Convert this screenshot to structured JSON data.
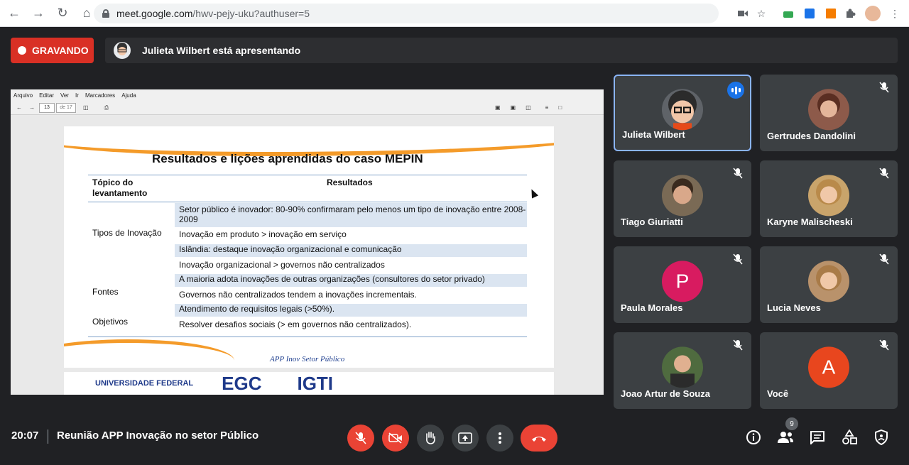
{
  "browser": {
    "url_host": "meet.google.com",
    "url_path": "/hwv-pejy-uku?authuser=5"
  },
  "banner": {
    "recording_label": "GRAVANDO",
    "presenting_text": "Julieta Wilbert está apresentando"
  },
  "pdf_viewer": {
    "menu": [
      "Arquivo",
      "Editar",
      "Ver",
      "Ir",
      "Marcadores",
      "Ajuda"
    ],
    "page_current": "13",
    "page_total": "de 17"
  },
  "slide": {
    "title": "Resultados e lições aprendidas do caso MEPIN",
    "col_topic": "Tópico do levantamento",
    "col_results": "Resultados",
    "row_labels": [
      "Tipos de Inovação",
      "Fontes",
      "Objetivos"
    ],
    "rows": [
      "Setor público é inovador: 80-90% confirmaram pelo menos um tipo de inovação entre 2008-2009",
      "Inovação em produto > inovação em serviço",
      "Islândia: destaque inovação organizacional e comunicação",
      "Inovação organizacional > governos não centralizados",
      "A maioria adota inovações de outras organizações (consultores do setor privado)",
      "Governos não centralizados tendem a inovações incrementais.",
      "Atendimento de requisitos legais (>50%).",
      "Resolver desafios sociais (> em governos não centralizados)."
    ],
    "footer": "APP Inov Setor Público",
    "logos": [
      "UNIVERSIDADE FEDERAL",
      "EGC",
      "IGTI"
    ]
  },
  "participants": [
    {
      "name": "Julieta Wilbert",
      "speaking": true,
      "avatar_color": "#5f6368"
    },
    {
      "name": "Gertrudes Dandolini",
      "muted": true,
      "avatar_color": "#8d5a4a"
    },
    {
      "name": "Tiago Giuriatti",
      "muted": true,
      "avatar_color": "#7a6a55"
    },
    {
      "name": "Karyne Malischeski",
      "muted": true,
      "avatar_color": "#c9a46b"
    },
    {
      "name": "Paula Morales",
      "muted": true,
      "initial": "P",
      "avatar_color": "#d81b60"
    },
    {
      "name": "Lucia Neves",
      "muted": true,
      "avatar_color": "#b9926b"
    },
    {
      "name": "Joao Artur de Souza",
      "muted": true,
      "avatar_color": "#4f6b3f"
    },
    {
      "name": "Você",
      "muted": true,
      "initial": "A",
      "avatar_color": "#e8461e"
    }
  ],
  "bottom_bar": {
    "time": "20:07",
    "meeting_title": "Reunião APP Inovação no setor Público",
    "people_count": "9"
  },
  "colors": {
    "accent_red": "#ea4335",
    "recording_red": "#d93025",
    "active_border": "#8ab4f8",
    "slide_orange": "#f49b2a"
  }
}
